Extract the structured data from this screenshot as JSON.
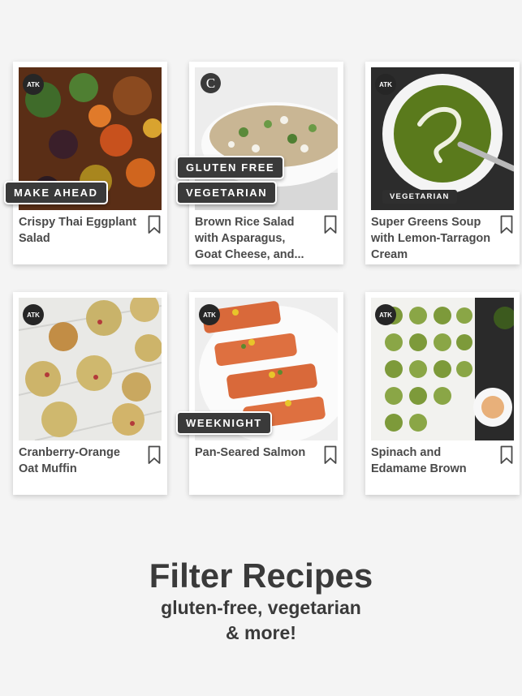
{
  "cards": [
    {
      "title": "Crispy Thai Eggplant Salad",
      "badge": "ATK"
    },
    {
      "title": "Brown Rice Salad with Asparagus, Goat Cheese, and...",
      "badge": "C"
    },
    {
      "title": "Super Greens Soup with Lemon-Tarragon Cream",
      "badge": "ATK",
      "photo_tag": "VEGETARIAN"
    },
    {
      "title": "Cranberry-Orange Oat Muffin",
      "badge": "ATK"
    },
    {
      "title": "Pan-Seared Salmon",
      "badge": "ATK"
    },
    {
      "title": "Spinach and Edamame Brown",
      "badge": "ATK"
    }
  ],
  "filter_tags": {
    "make_ahead": "MAKE AHEAD",
    "gluten_free": "GLUTEN FREE",
    "vegetarian": "VEGETARIAN",
    "weeknight": "WEEKNIGHT"
  },
  "promo": {
    "headline": "Filter Recipes",
    "subline_1": "gluten-free, vegetarian",
    "subline_2": "& more!"
  }
}
